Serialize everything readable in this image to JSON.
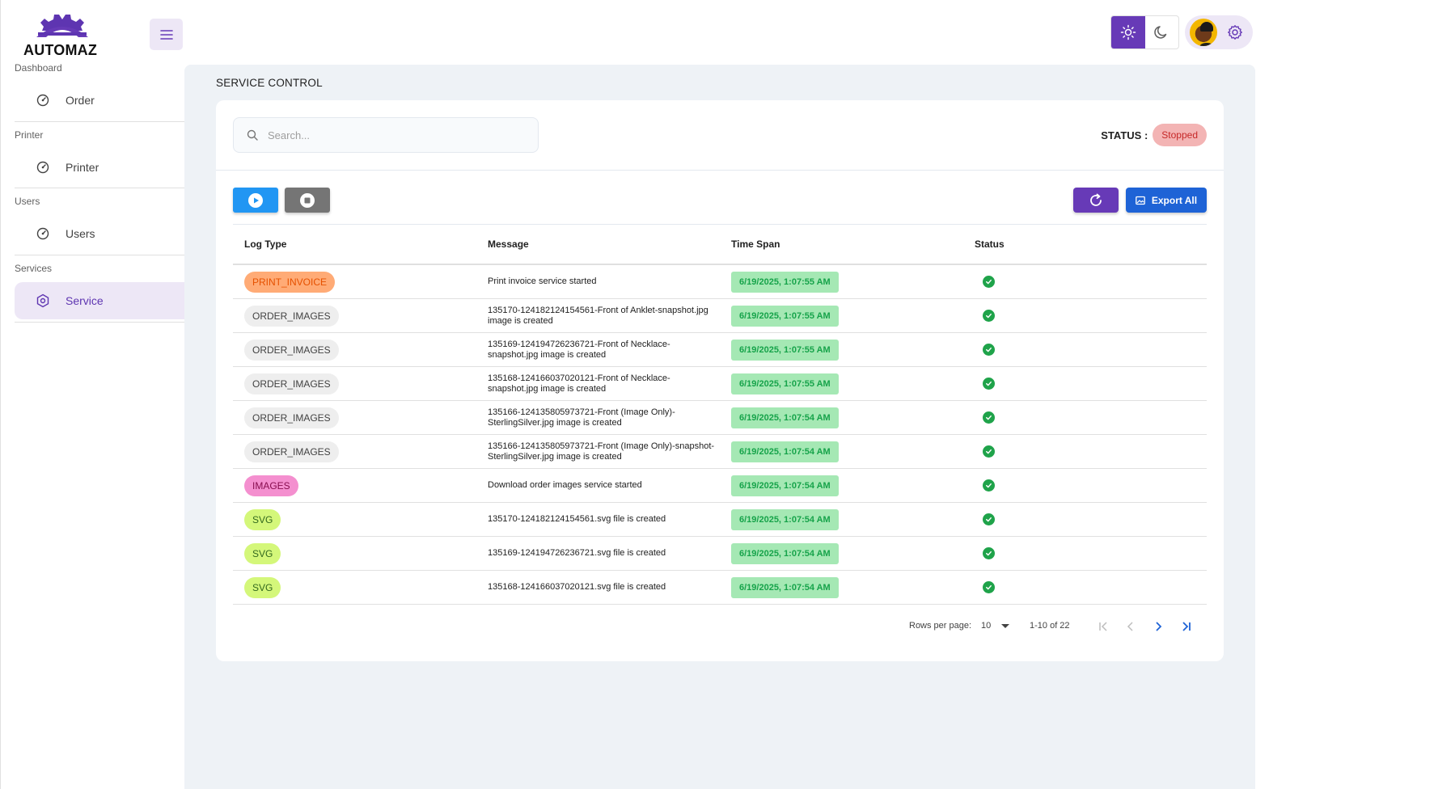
{
  "app": {
    "brand": "AUTOMAZ",
    "brand_color": "#673ab7"
  },
  "sidebar": {
    "groups": [
      {
        "caption": "Dashboard",
        "item": "Order",
        "icon": "dashboard-icon"
      },
      {
        "caption": "Printer",
        "item": "Printer",
        "icon": "dashboard-icon"
      },
      {
        "caption": "Users",
        "item": "Users",
        "icon": "dashboard-icon"
      },
      {
        "caption": "Services",
        "item": "Service",
        "icon": "settings-hex-icon",
        "active": true
      }
    ]
  },
  "topbar": {
    "theme_light_icon": "sun-icon",
    "theme_dark_icon": "moon-icon",
    "settings_icon": "gear-icon"
  },
  "page": {
    "title": "SERVICE CONTROL"
  },
  "search": {
    "placeholder": "Search..."
  },
  "status": {
    "label": "STATUS :",
    "value": "Stopped"
  },
  "toolbar": {
    "export_label": "Export All"
  },
  "table": {
    "headers": [
      "Log Type",
      "Message",
      "Time Span",
      "Status"
    ],
    "rows": [
      {
        "type": "PRINT_INVOICE",
        "kind": "print",
        "message": "Print invoice service started",
        "time": "6/19/2025, 1:07:55 AM"
      },
      {
        "type": "ORDER_IMAGES",
        "kind": "order",
        "message": "135170-124182124154561-Front of Anklet-snapshot.jpg image is created",
        "time": "6/19/2025, 1:07:55 AM"
      },
      {
        "type": "ORDER_IMAGES",
        "kind": "order",
        "message": "135169-124194726236721-Front of Necklace-snapshot.jpg image is created",
        "time": "6/19/2025, 1:07:55 AM"
      },
      {
        "type": "ORDER_IMAGES",
        "kind": "order",
        "message": "135168-124166037020121-Front of Necklace-snapshot.jpg image is created",
        "time": "6/19/2025, 1:07:55 AM"
      },
      {
        "type": "ORDER_IMAGES",
        "kind": "order",
        "message": "135166-124135805973721-Front (Image Only)-SterlingSilver.jpg image is created",
        "time": "6/19/2025, 1:07:54 AM"
      },
      {
        "type": "ORDER_IMAGES",
        "kind": "order",
        "message": "135166-124135805973721-Front (Image Only)-snapshot-SterlingSilver.jpg image is created",
        "time": "6/19/2025, 1:07:54 AM"
      },
      {
        "type": "IMAGES",
        "kind": "images",
        "message": "Download order images service started",
        "time": "6/19/2025, 1:07:54 AM"
      },
      {
        "type": "SVG",
        "kind": "svg",
        "message": "135170-124182124154561.svg file is created",
        "time": "6/19/2025, 1:07:54 AM"
      },
      {
        "type": "SVG",
        "kind": "svg",
        "message": "135169-124194726236721.svg file is created",
        "time": "6/19/2025, 1:07:54 AM"
      },
      {
        "type": "SVG",
        "kind": "svg",
        "message": "135168-124166037020121.svg file is created",
        "time": "6/19/2025, 1:07:54 AM"
      }
    ]
  },
  "pagination": {
    "rows_per_page_label": "Rows per page:",
    "rows_per_page": "10",
    "range": "1-10 of 22"
  }
}
